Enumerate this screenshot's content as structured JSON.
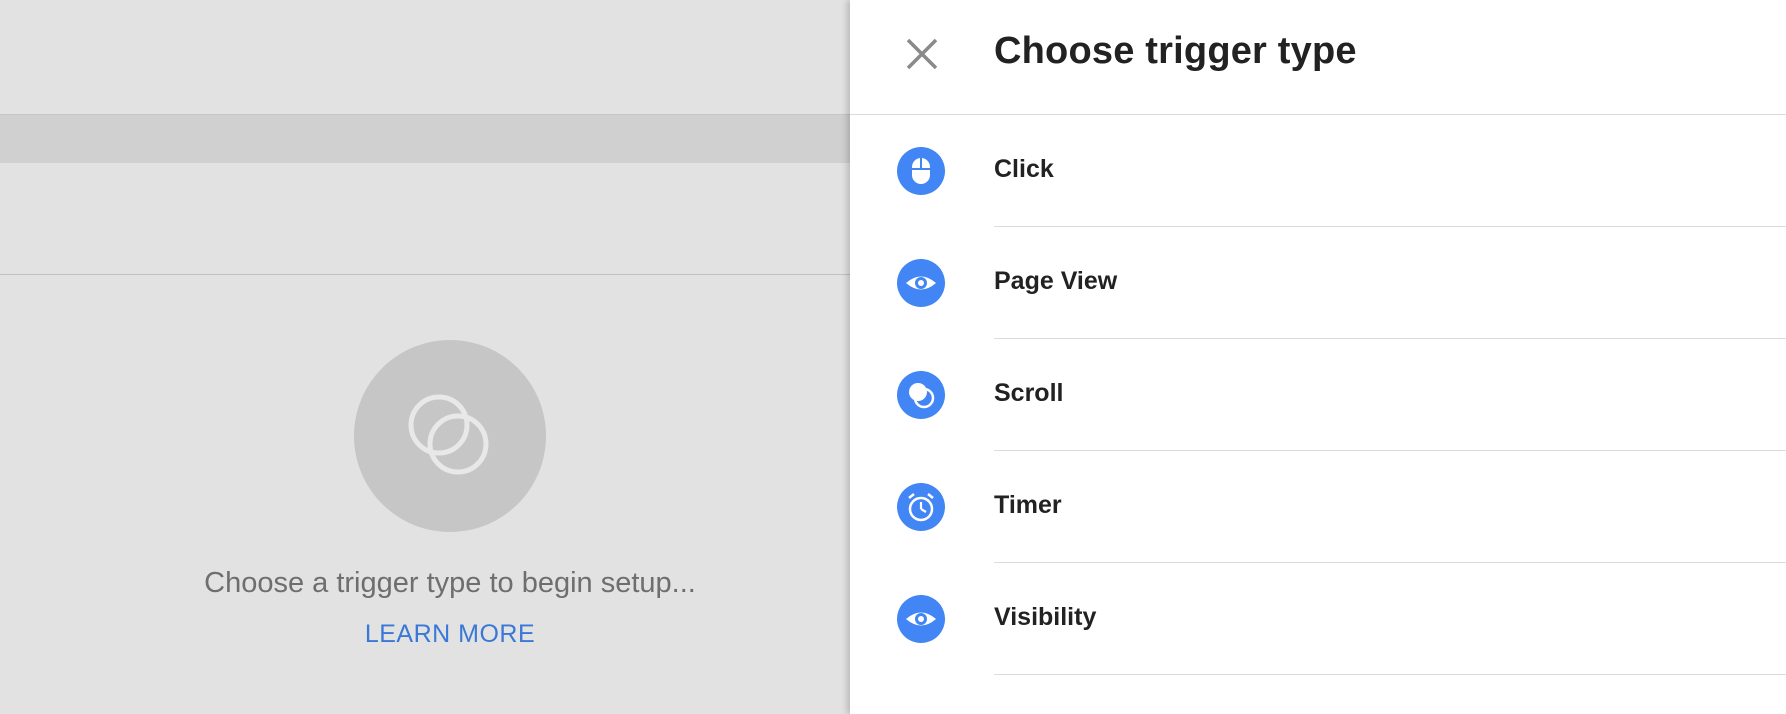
{
  "colors": {
    "accent": "#4285f4",
    "link": "#3a78d8",
    "background": "#e2e2e2"
  },
  "empty_state": {
    "icon": "trigger-overlap-circles-icon",
    "message": "Choose a trigger type to begin setup...",
    "learn_more": "LEARN MORE"
  },
  "drawer": {
    "close_icon": "close-icon",
    "title": "Choose trigger type",
    "items": [
      {
        "label": "Click",
        "icon": "mouse-icon"
      },
      {
        "label": "Page View",
        "icon": "eye-icon"
      },
      {
        "label": "Scroll",
        "icon": "scroll-circles-icon"
      },
      {
        "label": "Timer",
        "icon": "alarm-clock-icon"
      },
      {
        "label": "Visibility",
        "icon": "eye-icon"
      }
    ]
  }
}
